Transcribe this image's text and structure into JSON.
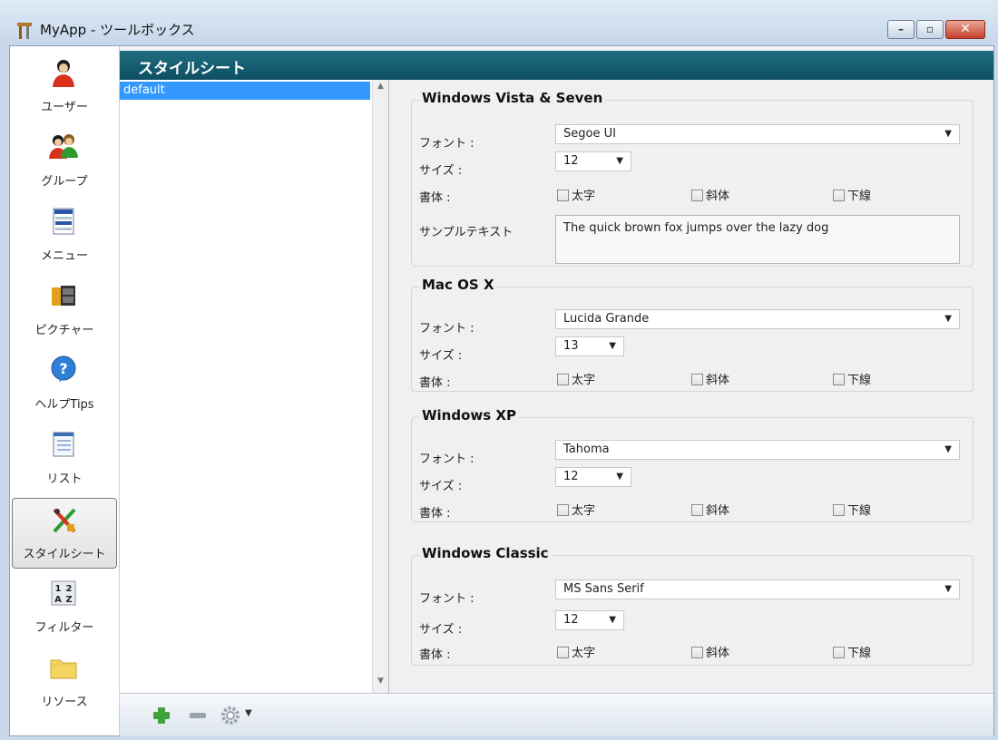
{
  "window": {
    "title": "MyApp - ツールボックス"
  },
  "nav": {
    "items": [
      {
        "label": "ユーザー",
        "icon": "user-icon"
      },
      {
        "label": "グループ",
        "icon": "group-icon"
      },
      {
        "label": "メニュー",
        "icon": "menu-icon"
      },
      {
        "label": "ピクチャー",
        "icon": "picture-icon"
      },
      {
        "label": "ヘルプTips",
        "icon": "help-icon"
      },
      {
        "label": "リスト",
        "icon": "list-icon"
      },
      {
        "label": "スタイルシート",
        "icon": "stylesheet-icon",
        "selected": true
      },
      {
        "label": "フィルター",
        "icon": "filter-icon"
      },
      {
        "label": "リソース",
        "icon": "folder-icon"
      }
    ]
  },
  "header": {
    "title": "スタイルシート"
  },
  "stylesheets": {
    "items": [
      "default"
    ],
    "selected": "default"
  },
  "groups": [
    {
      "title": "Windows Vista & Seven",
      "font_label": "フォント :",
      "font": "Segoe UI",
      "size_label": "サイズ :",
      "size": "12",
      "style_label": "書体 :",
      "bold": "太字",
      "italic": "斜体",
      "underline": "下線",
      "sample_label": "サンプルテキスト",
      "sample": "The quick brown fox jumps over the lazy dog"
    },
    {
      "title": "Mac OS X",
      "font_label": "フォント :",
      "font": "Lucida Grande",
      "size_label": "サイズ :",
      "size": "13",
      "style_label": "書体 :",
      "bold": "太字",
      "italic": "斜体",
      "underline": "下線"
    },
    {
      "title": "Windows XP",
      "font_label": "フォント :",
      "font": "Tahoma",
      "size_label": "サイズ :",
      "size": "12",
      "style_label": "書体 :",
      "bold": "太字",
      "italic": "斜体",
      "underline": "下線"
    },
    {
      "title": "Windows Classic",
      "font_label": "フォント :",
      "font": "MS Sans Serif",
      "size_label": "サイズ :",
      "size": "12",
      "style_label": "書体 :",
      "bold": "太字",
      "italic": "斜体",
      "underline": "下線"
    }
  ],
  "toolbar": {
    "add": "add-icon",
    "remove": "remove-icon",
    "settings": "gear-icon"
  }
}
